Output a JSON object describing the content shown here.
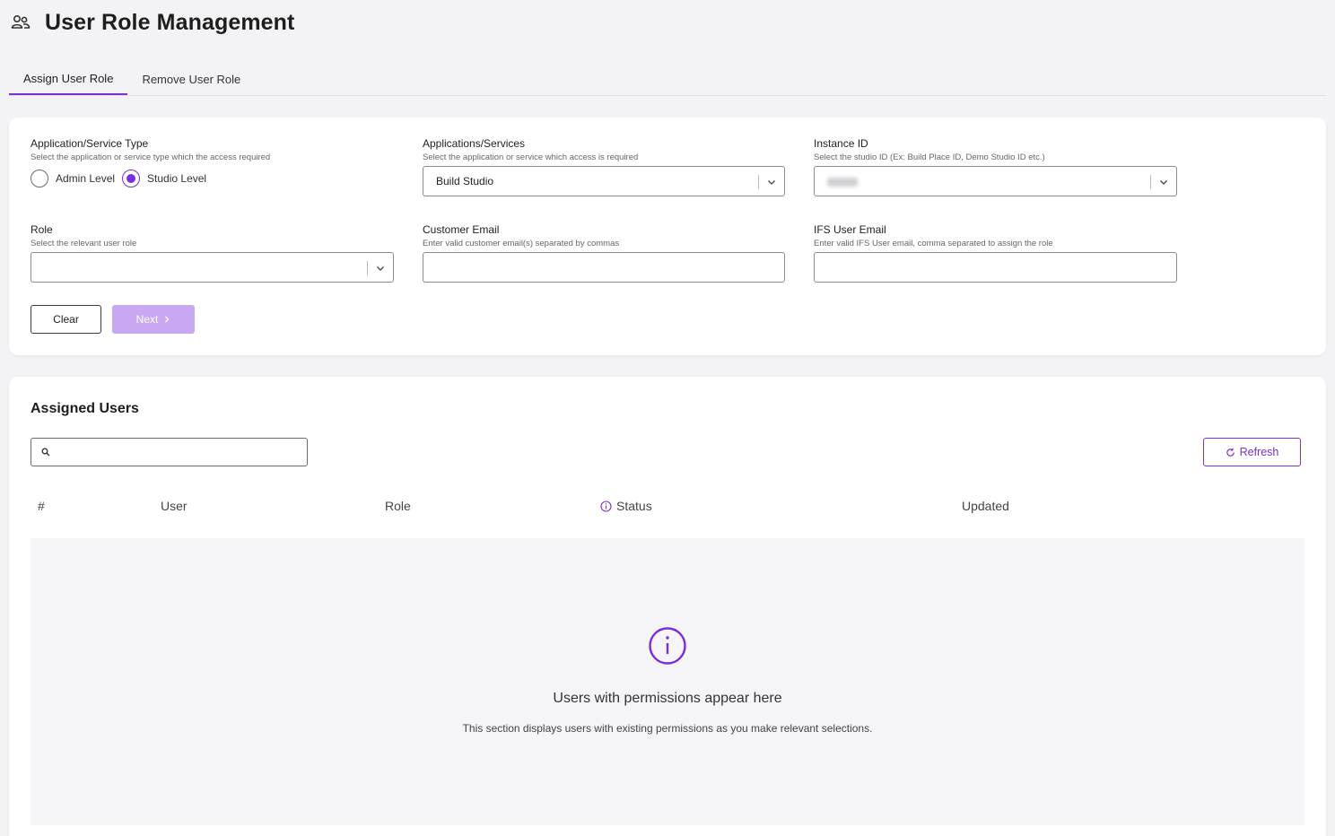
{
  "page": {
    "title": "User Role Management"
  },
  "tabs": [
    {
      "label": "Assign User Role",
      "active": true
    },
    {
      "label": "Remove User Role",
      "active": false
    }
  ],
  "form": {
    "app_type": {
      "label": "Application/Service Type",
      "hint": "Select the application or service type which the access required",
      "options": [
        {
          "label": "Admin Level",
          "checked": false
        },
        {
          "label": "Studio Level",
          "checked": true
        }
      ]
    },
    "applications": {
      "label": "Applications/Services",
      "hint": "Select the application or service which access is required",
      "value": "Build Studio"
    },
    "instance": {
      "label": "Instance ID",
      "hint": "Select the studio ID (Ex: Build Place ID, Demo Studio ID etc.)"
    },
    "role": {
      "label": "Role",
      "hint": "Select the relevant user role",
      "value": ""
    },
    "customer_email": {
      "label": "Customer Email",
      "hint": "Enter valid customer email(s) separated by commas",
      "value": ""
    },
    "ifs_email": {
      "label": "IFS User Email",
      "hint": "Enter valid IFS User email, comma separated to assign the role",
      "value": ""
    },
    "clear_label": "Clear",
    "next_label": "Next"
  },
  "users": {
    "title": "Assigned Users",
    "search_value": "",
    "refresh_label": "Refresh",
    "columns": [
      "#",
      "User",
      "Role",
      "Status",
      "Updated"
    ],
    "empty_title": "Users with permissions appear here",
    "empty_subtitle": "This section displays users with existing permissions as you make relevant selections."
  },
  "colors": {
    "accent": "#7b2fd6",
    "accent_disabled": "#c9a8f1"
  }
}
